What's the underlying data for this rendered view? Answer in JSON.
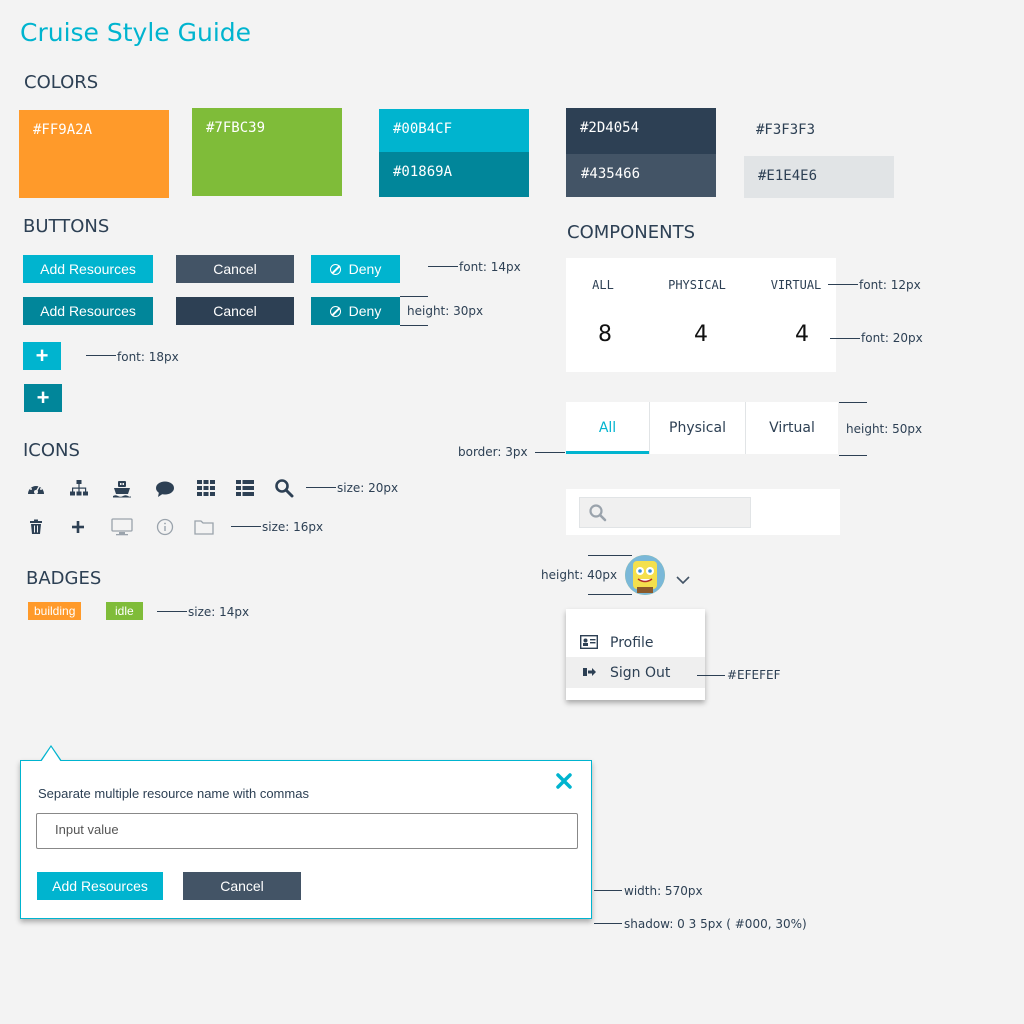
{
  "page_title": "Cruise Style Guide",
  "sections": {
    "colors": "COLORS",
    "buttons": "BUTTONS",
    "components": "COMPONENTS",
    "icons": "ICONS",
    "badges": "BADGES"
  },
  "colors": [
    {
      "hex": "#FF9A2A"
    },
    {
      "hex": "#7FBC39"
    },
    {
      "hex": "#00B4CF"
    },
    {
      "hex": "#01869A"
    },
    {
      "hex": "#2D4054"
    },
    {
      "hex": "#435466"
    },
    {
      "hex": "#F3F3F3"
    },
    {
      "hex": "#E1E4E6"
    }
  ],
  "buttons": {
    "add_resources": "Add Resources",
    "cancel": "Cancel",
    "deny": "Deny",
    "plus": "+"
  },
  "notes": {
    "font14": "font: 14px",
    "height30": "height: 30px",
    "font18": "font: 18px",
    "size20": "size: 20px",
    "size16": "size: 16px",
    "size14": "size: 14px",
    "font12": "font: 12px",
    "font20": "font: 20px",
    "border3": "border: 3px",
    "height50": "height: 50px",
    "height40": "height: 40px",
    "efefef": "#EFEFEF",
    "width570": "width: 570px",
    "shadow": "shadow: 0 3 5px ( #000, 30%)"
  },
  "icons_row1": [
    "dashboard-icon",
    "sitemap-icon",
    "ship-icon",
    "comment-icon",
    "grid-icon",
    "list-icon",
    "search-icon"
  ],
  "icons_row2": [
    "trash-icon",
    "plus-icon",
    "monitor-icon",
    "info-icon",
    "folder-icon"
  ],
  "badges": {
    "building": "building",
    "idle": "idle"
  },
  "stats": {
    "labels": [
      "ALL",
      "PHYSICAL",
      "VIRTUAL"
    ],
    "values": [
      "8",
      "4",
      "4"
    ]
  },
  "tabs": [
    "All",
    "Physical",
    "Virtual"
  ],
  "search": {
    "placeholder": ""
  },
  "menu": {
    "profile": "Profile",
    "sign_out": "Sign Out"
  },
  "dialog": {
    "label": "Separate multiple resource name with commas",
    "input_placeholder": "Input value",
    "add": "Add Resources",
    "cancel": "Cancel"
  }
}
